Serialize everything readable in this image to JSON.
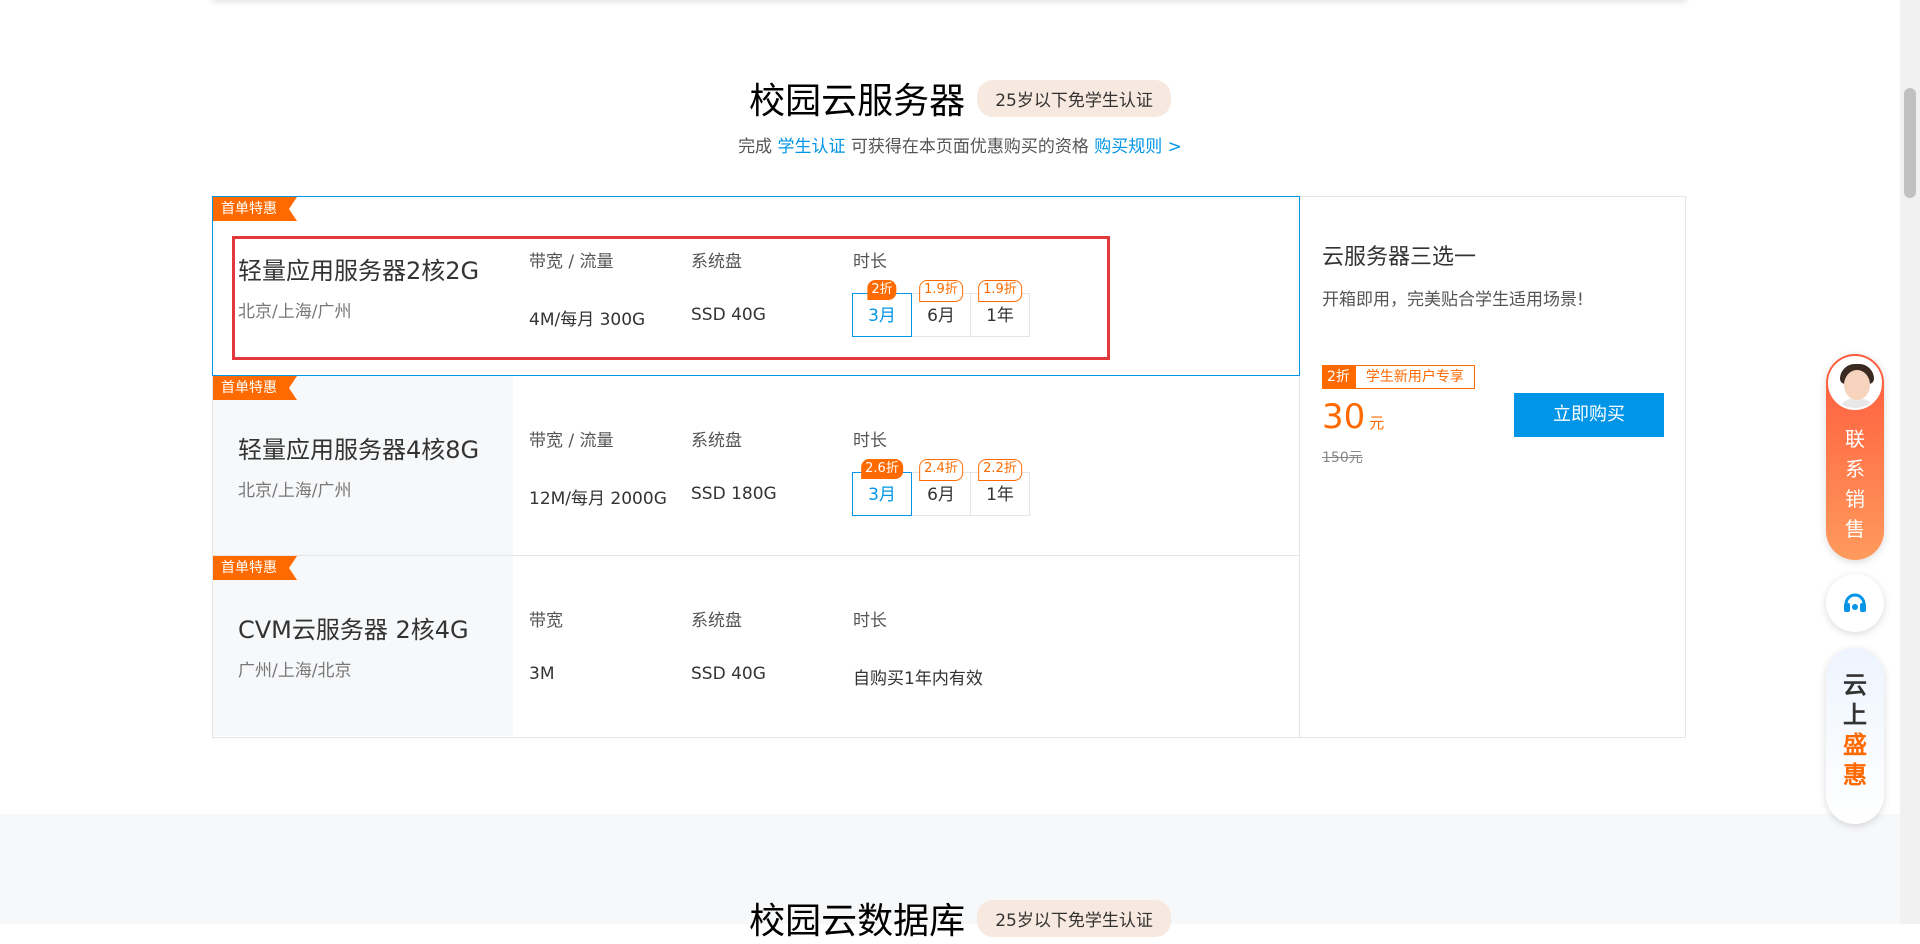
{
  "section": {
    "title": "校园云服务器",
    "badge": "25岁以下免学生认证",
    "subtitle_prefix": "完成",
    "subtitle_link1": "学生认证",
    "subtitle_mid": "可获得在本页面优惠购买的资格",
    "subtitle_link2": "购买规则 >"
  },
  "products": [
    {
      "tag": "首单特惠",
      "name": "轻量应用服务器2核2G",
      "region": "北京/上海/广州",
      "col1_label": "带宽 / 流量",
      "col1_value": "4M/每月 300G",
      "col2_label": "系统盘",
      "col2_value": "SSD 40G",
      "col3_label": "时长",
      "durations": [
        {
          "label": "3月",
          "discount": "2折"
        },
        {
          "label": "6月",
          "discount": "1.9折"
        },
        {
          "label": "1年",
          "discount": "1.9折"
        }
      ]
    },
    {
      "tag": "首单特惠",
      "name": "轻量应用服务器4核8G",
      "region": "北京/上海/广州",
      "col1_label": "带宽 / 流量",
      "col1_value": "12M/每月 2000G",
      "col2_label": "系统盘",
      "col2_value": "SSD 180G",
      "col3_label": "时长",
      "durations": [
        {
          "label": "3月",
          "discount": "2.6折"
        },
        {
          "label": "6月",
          "discount": "2.4折"
        },
        {
          "label": "1年",
          "discount": "2.2折"
        }
      ]
    },
    {
      "tag": "首单特惠",
      "name": "CVM云服务器 2核4G",
      "region": "广州/上海/北京",
      "col1_label": "带宽",
      "col1_value": "3M",
      "col2_label": "系统盘",
      "col2_value": "SSD 40G",
      "col3_label": "时长",
      "col3_value": "自购买1年内有效"
    }
  ],
  "side": {
    "title": "云服务器三选一",
    "desc": "开箱即用，完美贴合学生适用场景!",
    "badge_discount": "2折",
    "badge_label": "学生新用户专享",
    "price": "30",
    "price_unit": "元",
    "old_price": "150元",
    "buy_label": "立即购买"
  },
  "section2": {
    "title": "校园云数据库",
    "badge": "25岁以下免学生认证"
  },
  "float": {
    "sales_chars": [
      "联",
      "系",
      "销",
      "售"
    ],
    "promo_chars": [
      "云",
      "上",
      "盛",
      "惠"
    ]
  },
  "colors": {
    "accent": "#0095e6",
    "orange": "#ff6a00",
    "highlight": "#e4393c"
  }
}
